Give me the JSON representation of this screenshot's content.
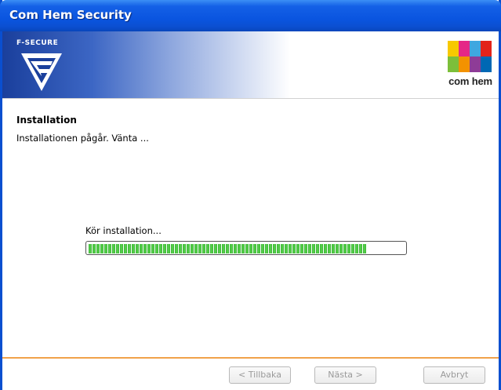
{
  "window": {
    "title": "Com Hem Security"
  },
  "banner": {
    "brand_left": "F-SECURE",
    "brand_right": "com hem"
  },
  "content": {
    "heading": "Installation",
    "subtitle": "Installationen pågår. Vänta ...",
    "progress_label": "Kör installation...",
    "progress": 0.88
  },
  "buttons": {
    "back": "< Tillbaka",
    "next": "Nästa >",
    "cancel": "Avbryt"
  },
  "colors": {
    "titlebar": "#0a55e0",
    "progress": "#37b033",
    "divider": "#f1a24a"
  },
  "icons": {
    "left_logo": "f-secure-logo",
    "right_logo": "com-hem-logo"
  }
}
